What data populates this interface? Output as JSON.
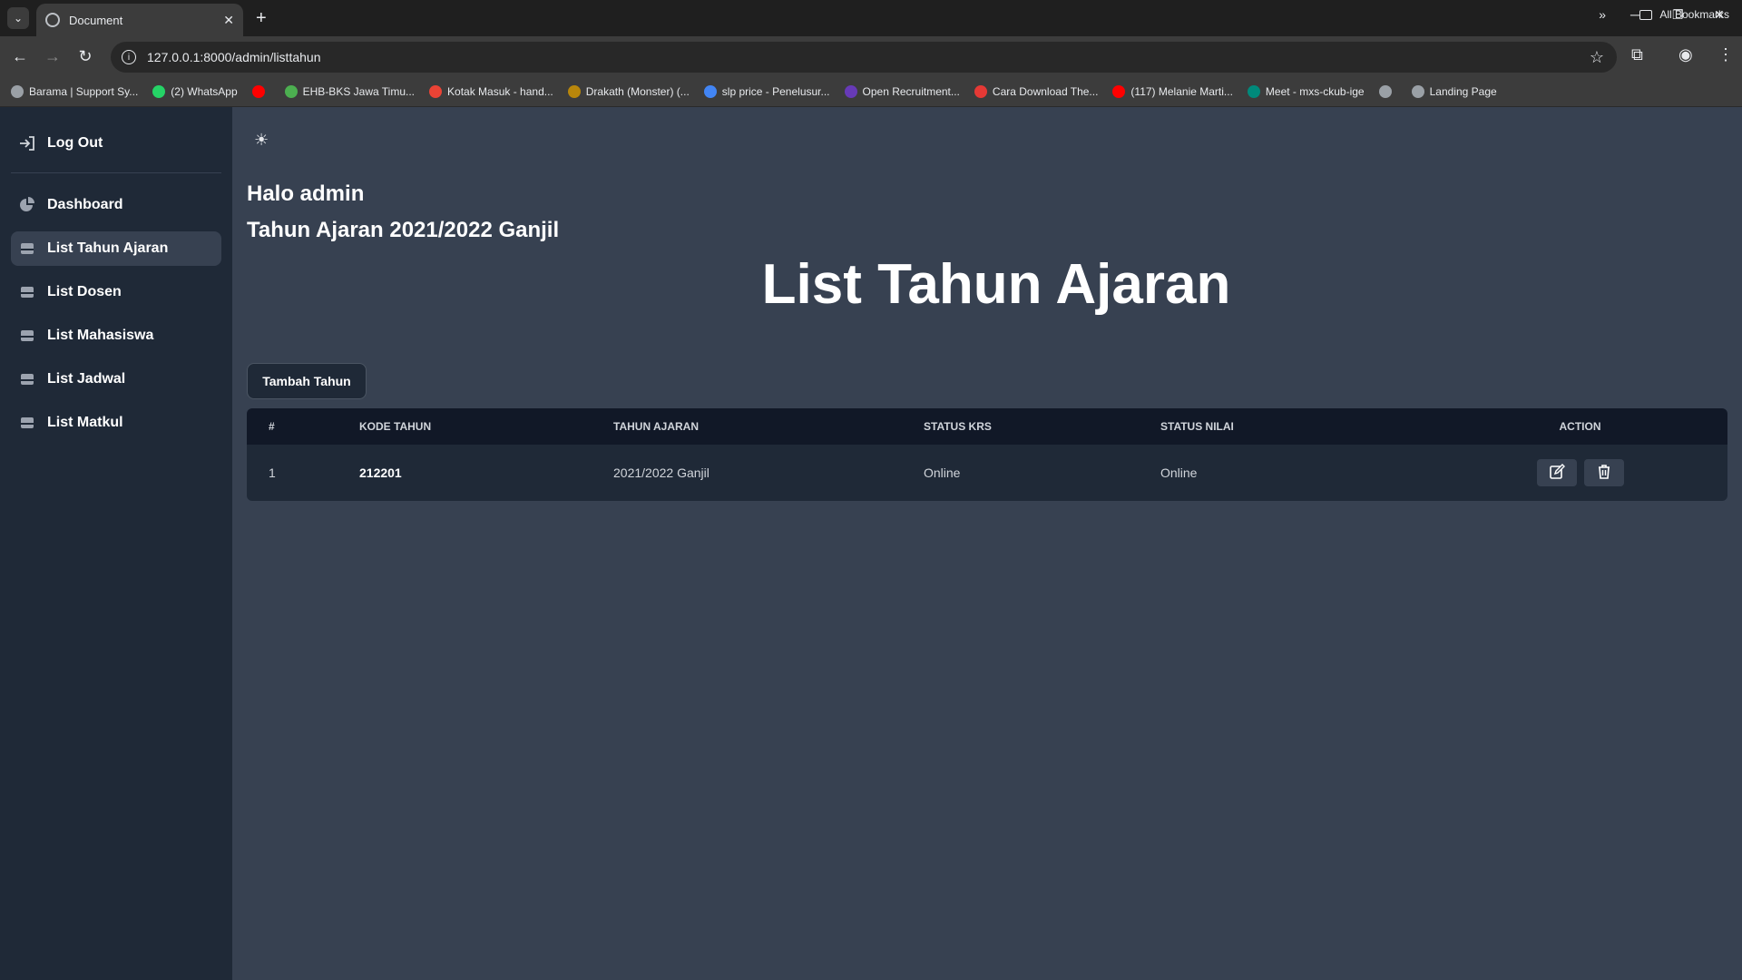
{
  "browser": {
    "tab_title": "Document",
    "url": "127.0.0.1:8000/admin/listtahun",
    "bookmarks": [
      {
        "label": "Barama | Support Sy...",
        "color": "#9aa0a6"
      },
      {
        "label": "(2) WhatsApp",
        "color": "#25d366"
      },
      {
        "label": "",
        "color": "#ff0000"
      },
      {
        "label": "EHB-BKS Jawa Timu...",
        "color": "#4caf50"
      },
      {
        "label": "Kotak Masuk - hand...",
        "color": "#ea4335"
      },
      {
        "label": "Drakath (Monster) (...",
        "color": "#b8860b"
      },
      {
        "label": "slp price - Penelusur...",
        "color": "#4285f4"
      },
      {
        "label": "Open Recruitment...",
        "color": "#673ab7"
      },
      {
        "label": "Cara Download The...",
        "color": "#e53935"
      },
      {
        "label": "(117) Melanie Marti...",
        "color": "#ff0000"
      },
      {
        "label": "Meet - mxs-ckub-ige",
        "color": "#00897b"
      },
      {
        "label": "",
        "color": "#9aa0a6"
      },
      {
        "label": "Landing Page",
        "color": "#9aa0a6"
      }
    ],
    "all_bookmarks": "All Bookmarks"
  },
  "sidebar": {
    "logout": "Log Out",
    "items": [
      {
        "label": "Dashboard",
        "icon": "chart-pie-icon"
      },
      {
        "label": "List Tahun Ajaran",
        "icon": "inbox-icon",
        "active": true
      },
      {
        "label": "List Dosen",
        "icon": "inbox-icon"
      },
      {
        "label": "List Mahasiswa",
        "icon": "inbox-icon"
      },
      {
        "label": "List Jadwal",
        "icon": "inbox-icon"
      },
      {
        "label": "List Matkul",
        "icon": "inbox-icon"
      }
    ]
  },
  "main": {
    "greeting": "Halo admin",
    "term": "Tahun Ajaran 2021/2022 Ganjil",
    "title": "List Tahun Ajaran",
    "add_button": "Tambah Tahun"
  },
  "table": {
    "headers": [
      "#",
      "KODE TAHUN",
      "TAHUN AJARAN",
      "STATUS KRS",
      "STATUS NILAI",
      "ACTION"
    ],
    "rows": [
      [
        "1",
        "212201",
        "2021/2022 Ganjil",
        "Online",
        "Online"
      ]
    ]
  }
}
